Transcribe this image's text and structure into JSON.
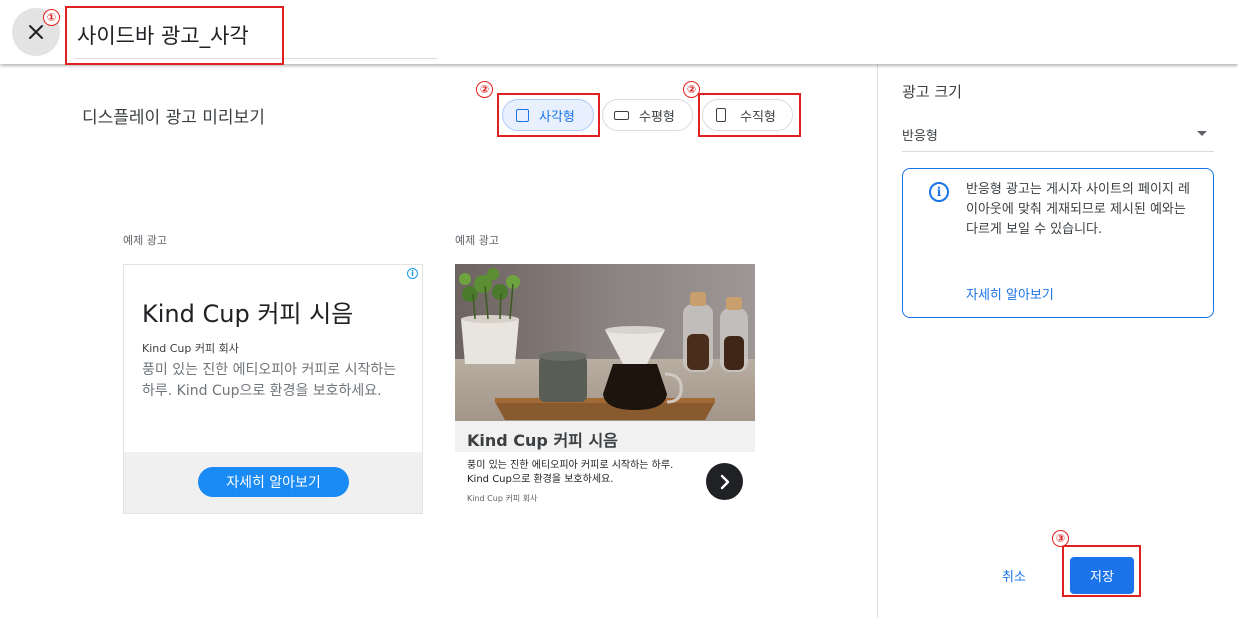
{
  "header": {
    "title": "사이드바 광고_사각",
    "close_icon": "close-icon"
  },
  "annotations": {
    "num1": "①",
    "num2": "②",
    "num3": "③",
    "color": "#e02020"
  },
  "preview": {
    "title": "디스플레이 광고 미리보기",
    "shapes": [
      {
        "label": "사각형",
        "icon": "square-icon",
        "active": true
      },
      {
        "label": "수평형",
        "icon": "horizontal-rectangle-icon",
        "active": false
      },
      {
        "label": "수직형",
        "icon": "vertical-rectangle-icon",
        "active": false
      }
    ],
    "ad_label": "예제 광고"
  },
  "ad1": {
    "headline": "Kind Cup 커피 시음",
    "advertiser": "Kind Cup 커피 회사",
    "description": "풍미 있는 진한 에티오피아 커피로 시작하는 하루. Kind Cup으로 환경을 보호하세요.",
    "cta": "자세히 알아보기",
    "adchoices_glyph": "i"
  },
  "ad2": {
    "headline": "Kind Cup 커피 시음",
    "description": "풍미 있는 진한 에티오피아 커피로 시작하는 하루. Kind Cup으로 환경을 보호하세요.",
    "advertiser": "Kind Cup 커피 회사",
    "arrow_icon": "chevron-right-icon"
  },
  "sidebar": {
    "size_label": "광고 크기",
    "size_value": "반응형",
    "info_text": "반응형 광고는 게시자 사이트의 페이지 레이아웃에 맞춰 게재되므로 제시된 예와는 다르게 보일 수 있습니다.",
    "info_link": "자세히 알아보기",
    "info_glyph": "i"
  },
  "actions": {
    "cancel": "취소",
    "save": "저장"
  },
  "colors": {
    "accent": "#1a73e8",
    "cta": "#1a8af5",
    "annotation": "#e02020"
  }
}
